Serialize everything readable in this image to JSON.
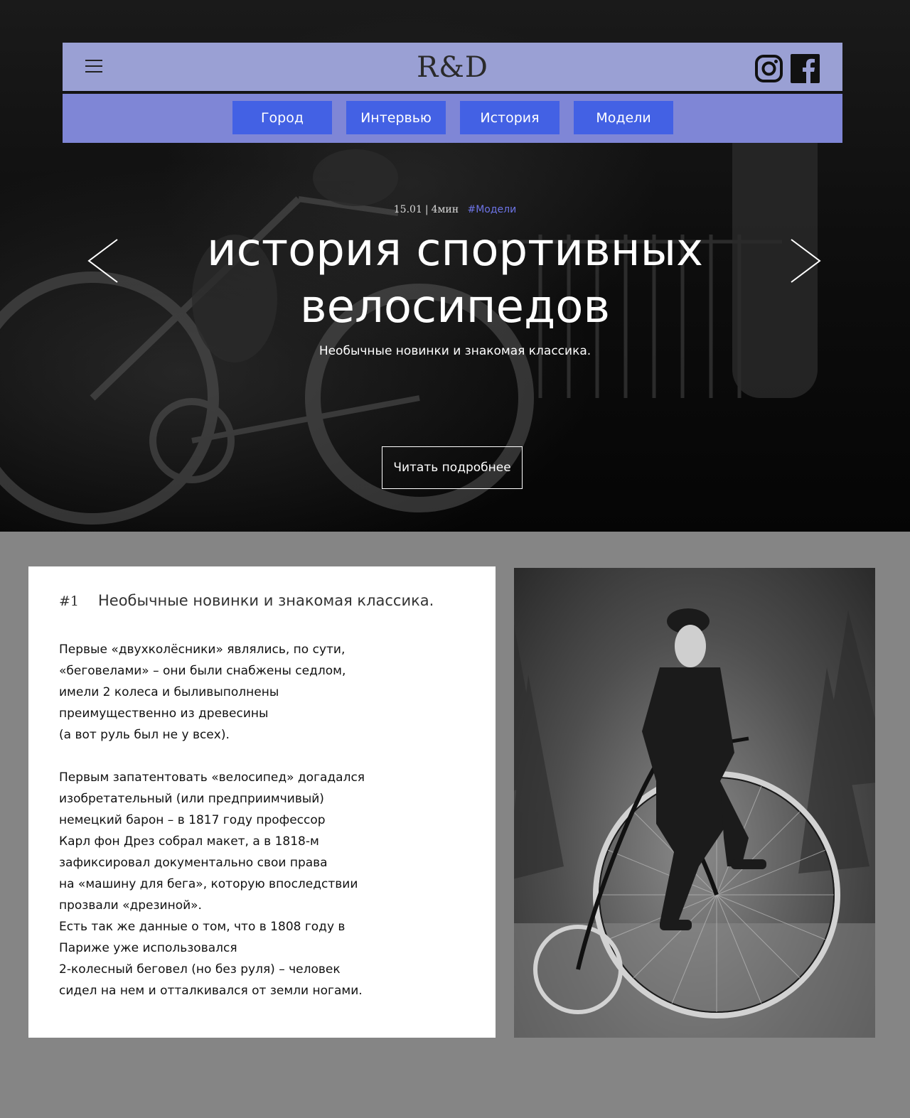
{
  "header": {
    "logo": "R&D",
    "menu_icon": "hamburger-menu-icon",
    "social": [
      {
        "name": "instagram-icon"
      },
      {
        "name": "facebook-icon"
      }
    ],
    "colors": {
      "bar": "#9aa0d4",
      "nav_bar": "#7f86d6",
      "nav_button": "#4361e4"
    }
  },
  "nav": {
    "items": [
      "Город",
      "Интервью",
      "История",
      "Модели"
    ]
  },
  "hero": {
    "date": "15.01",
    "separator": "|",
    "read_time": "4мин",
    "tag": "#Модели",
    "title_line1": "история спортивных",
    "title_line2": "велосипедов",
    "subtitle": "Необычные новинки и знакомая классика.",
    "read_more": "Читать подробнее",
    "prev_icon": "chevron-left-icon",
    "next_icon": "chevron-right-icon"
  },
  "article": {
    "number": "#1",
    "title": "Необычные новинки и знакомая классика.",
    "paragraph1": "Первые «двухколёсники» являлись, по сути,\n«беговелами» – они были снабжены седлом,\nимели 2 колеса и быливыполнены\nпреимущественно из древесины\n(а вот руль был не у всех).",
    "paragraph2": "Первым запатентовать «велосипед» догадался\nизобретательный (или предприимчивый)\nнемецкий барон – в 1817 году профессор\nКарл фон Дрез собрал макет, а в 1818-м\nзафиксировал документально свои права\nна «машину для бега», которую впоследствии\nпрозвали «дрезиной».\nЕсть так же данные о том, что в 1808 году в\nПариже уже использовался\n2-колесный беговел (но без руля) – человек\nсидел на нем и отталкивался от земли ногами."
  }
}
